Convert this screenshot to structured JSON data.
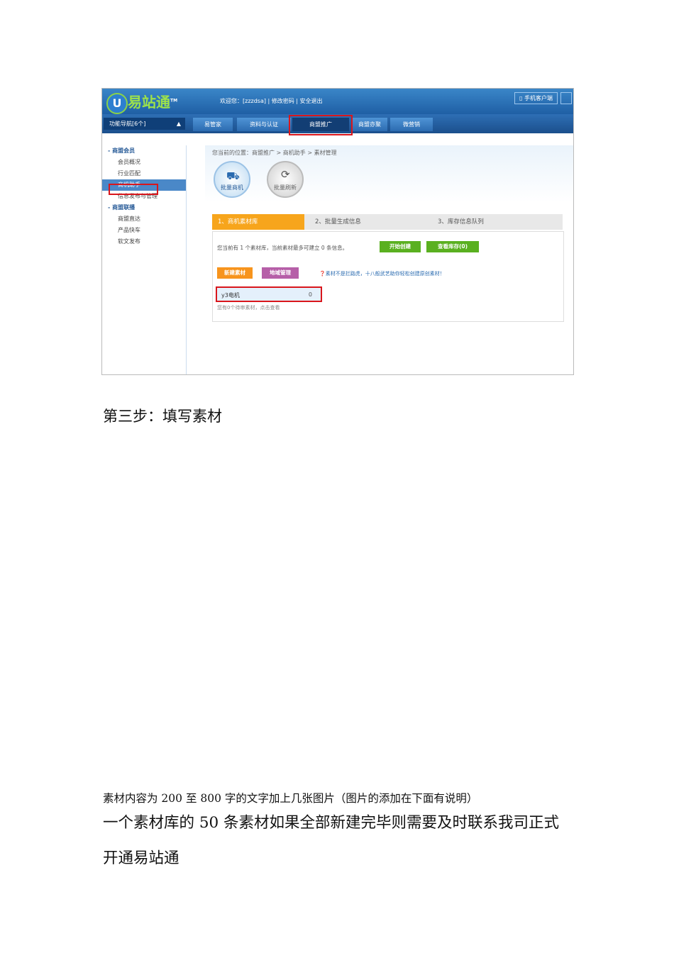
{
  "screenshot": {
    "logo": "易站通",
    "logo_letter": "U",
    "tm": "TM",
    "welcome": "欢迎您：[zzzdsa] | 修改密码 | 安全退出",
    "mobile_client": "手机客户端",
    "nav_select": "功能导航[6个]",
    "tabs": [
      "易管家",
      "资料与认证",
      "商盟推广",
      "商盟亦聚",
      "微营销"
    ],
    "sidebar": [
      {
        "label": "商盟会员",
        "group": true
      },
      {
        "label": "会员概况"
      },
      {
        "label": "行业匹配"
      },
      {
        "label": "商机助手",
        "selected": true
      },
      {
        "label": "信息发布与管理"
      },
      {
        "label": "商盟联播",
        "group": true
      },
      {
        "label": "商盟直达"
      },
      {
        "label": "产品快车"
      },
      {
        "label": "软文发布"
      }
    ],
    "breadcrumb": "您当前的位置：商盟推广 > 商机助手 > 素材管理",
    "circle1": "批量商机",
    "circle2": "批量刷新",
    "steps": [
      "1、商机素材库",
      "2、批量生成信息",
      "3、库存信息队列"
    ],
    "info_text": "您当前有 1 个素材库，当前素材最多可建立 0 条信息。",
    "btn_start": "开始创建",
    "btn_stock": "查看库存(0)",
    "btn_new": "新建素材",
    "btn_region": "地域管理",
    "hint": "素材不是拦路虎，十八般武艺助你轻松创建原创素材！",
    "library_name": "y3电机",
    "library_count": "0",
    "footer_note": "您有0个待审素材，点击查看"
  },
  "document": {
    "step_heading": "第三步：填写素材",
    "note": "素材内容为 200 至 800 字的文字加上几张图片（图片的添加在下面有说明）",
    "para_line1": "一个素材库的 50 条素材如果全部新建完毕则需要及时联系我司正式",
    "para_line2": "开通易站通"
  }
}
